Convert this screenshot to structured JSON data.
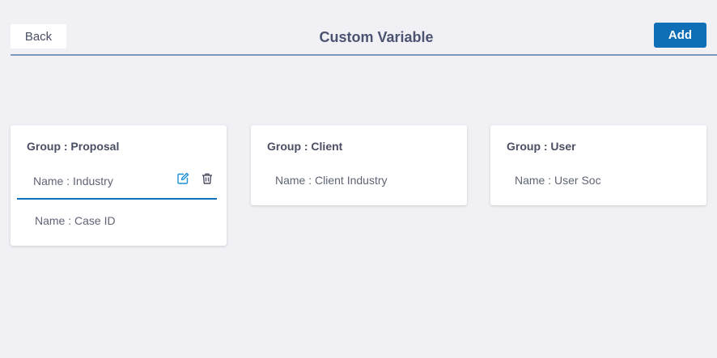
{
  "header": {
    "back_label": "Back",
    "title": "Custom Variable",
    "add_label": "Add"
  },
  "groups": [
    {
      "title": "Group : Proposal",
      "items": [
        {
          "label": "Name : Industry"
        },
        {
          "label": "Name : Case ID"
        }
      ]
    },
    {
      "title": "Group : Client",
      "items": [
        {
          "label": "Name : Client Industry"
        }
      ]
    },
    {
      "title": "Group : User",
      "items": [
        {
          "label": "Name : User Soc"
        }
      ]
    }
  ],
  "icons": {
    "edit": "edit-icon",
    "delete": "trash-icon"
  },
  "colors": {
    "accent": "#0e6fb6",
    "background": "#f0f0f5",
    "title_text": "#4c5370"
  }
}
